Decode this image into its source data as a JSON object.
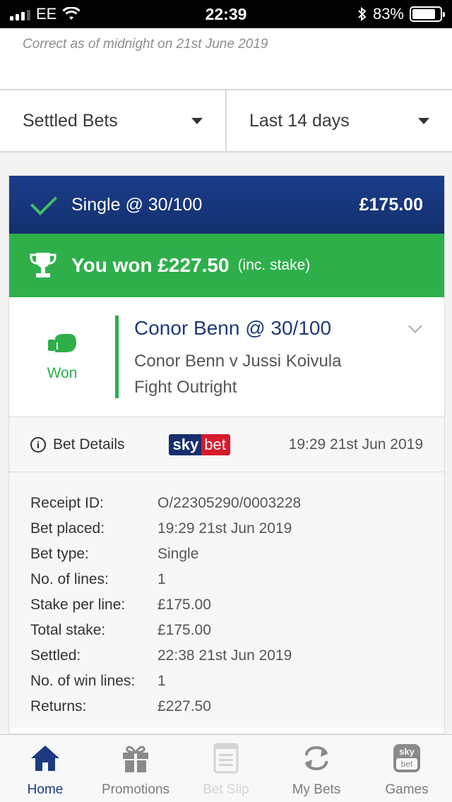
{
  "status_bar": {
    "carrier": "EE",
    "time": "22:39",
    "battery": "83%",
    "battery_level": 0.83
  },
  "note": "Correct as of midnight on 21st June 2019",
  "filters": {
    "type": "Settled Bets",
    "period": "Last 14 days"
  },
  "bet": {
    "title": "Single @ 30/100",
    "stake": "£175.00",
    "won_text": "You won £227.50",
    "won_note": "(inc. stake)",
    "result": "Won",
    "selection": "Conor Benn @ 30/100",
    "event": "Conor Benn v Jussi Koivula",
    "market": "Fight Outright"
  },
  "details": {
    "label": "Bet Details",
    "logo_sky": "sky",
    "logo_bet": "bet",
    "date": "19:29 21st Jun 2019"
  },
  "receipt": [
    {
      "k": "Receipt ID:",
      "v": "O/22305290/0003228"
    },
    {
      "k": "Bet placed:",
      "v": "19:29 21st Jun 2019"
    },
    {
      "k": "Bet type:",
      "v": "Single"
    },
    {
      "k": "No. of lines:",
      "v": "1"
    },
    {
      "k": "Stake per line:",
      "v": "£175.00"
    },
    {
      "k": "Total stake:",
      "v": "£175.00"
    },
    {
      "k": "Settled:",
      "v": "22:38 21st Jun 2019"
    },
    {
      "k": "No. of win lines:",
      "v": "1"
    },
    {
      "k": "Returns:",
      "v": "£227.50"
    }
  ],
  "tabs": [
    {
      "label": "Home",
      "icon": "home-icon"
    },
    {
      "label": "Promotions",
      "icon": "gift-icon"
    },
    {
      "label": "Bet Slip",
      "icon": "betslip-icon"
    },
    {
      "label": "My Bets",
      "icon": "refresh-icon"
    },
    {
      "label": "Games",
      "icon": "skybet-games-icon",
      "badge_top": "sky",
      "badge_bottom": "bet"
    }
  ],
  "colors": {
    "brand_blue": "#1a3d8a",
    "win_green": "#2eaf4a",
    "skybet_red": "#d7192b"
  }
}
